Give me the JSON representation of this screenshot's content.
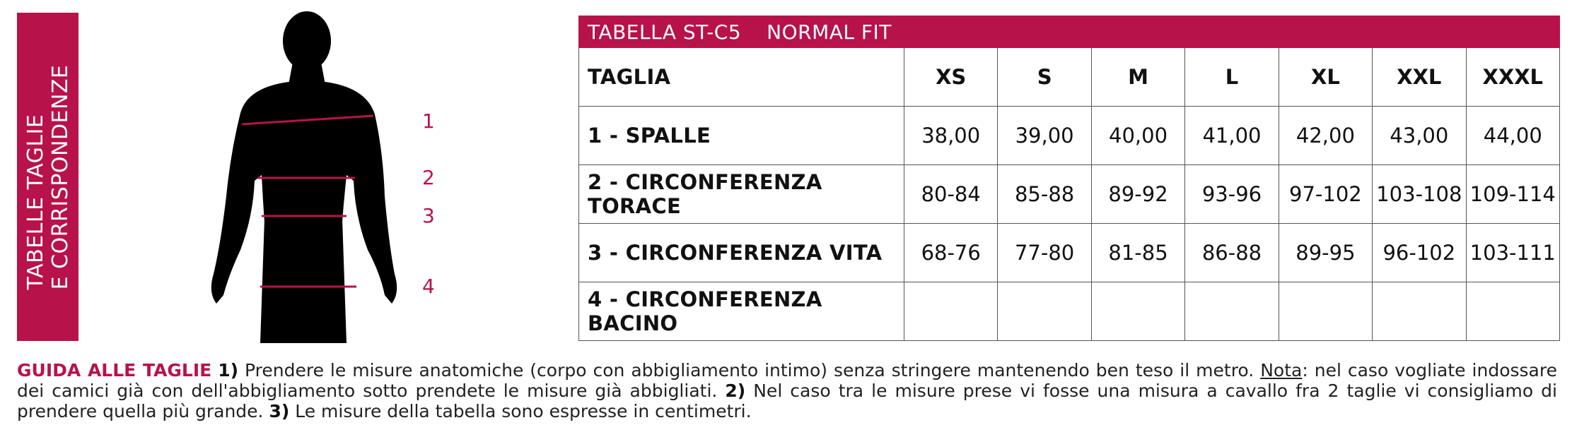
{
  "sidebar": {
    "line1": "TABELLE TAGLIE",
    "line2": "E CORRISPONDENZE"
  },
  "figure": {
    "markers": [
      "1",
      "2",
      "3",
      "4"
    ]
  },
  "colors": {
    "accent": "#b8124b",
    "silhouette": "#000000"
  },
  "table": {
    "code": "TABELLA ST-C5",
    "fit": "NORMAL FIT",
    "size_label": "TAGLIA",
    "sizes": [
      "XS",
      "S",
      "M",
      "L",
      "XL",
      "XXL",
      "XXXL"
    ],
    "rows": [
      {
        "label": "1 - SPALLE",
        "values": [
          "38,00",
          "39,00",
          "40,00",
          "41,00",
          "42,00",
          "43,00",
          "44,00"
        ]
      },
      {
        "label": "2 - CIRCONFERENZA TORACE",
        "values": [
          "80-84",
          "85-88",
          "89-92",
          "93-96",
          "97-102",
          "103-108",
          "109-114"
        ]
      },
      {
        "label": "3 - CIRCONFERENZA VITA",
        "values": [
          "68-76",
          "77-80",
          "81-85",
          "86-88",
          "89-95",
          "96-102",
          "103-111"
        ]
      },
      {
        "label": "4 - CIRCONFERENZA BACINO",
        "values": [
          "",
          "",
          "",
          "",
          "",
          "",
          ""
        ]
      }
    ]
  },
  "guide": {
    "title": "GUIDA ALLE TAGLIE",
    "n1": "1)",
    "t1": "Prendere le misure anatomiche (corpo con abbigliamento intimo) senza stringere mantenendo ben teso il metro.",
    "nota_label": "Nota",
    "t1b": ": nel caso vogliate indossare dei camici già con dell'abbigliamento sotto prendete le misure già abbigliati.",
    "n2": "2)",
    "t2": "Nel caso tra le misure prese vi fosse una misura a cavallo fra 2 taglie vi consigliamo di prendere quella più grande.",
    "n3": "3)",
    "t3": "Le misure della tabella sono espresse in centimetri."
  }
}
